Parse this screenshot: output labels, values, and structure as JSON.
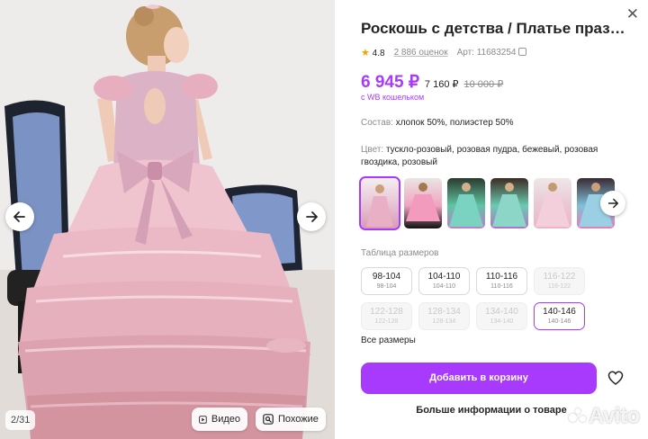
{
  "gallery": {
    "counter": "2/31",
    "video_label": "Видео",
    "similar_label": "Похожие"
  },
  "product": {
    "title": "Роскошь с детства / Платье праздничное",
    "rating": "4.8",
    "reviews": "2 886 оценок",
    "article": "Арт: 11683254",
    "price_main": "6 945 ₽",
    "price_sub": "7 160 ₽",
    "price_old": "10 000 ₽",
    "wallet_note": "с WB кошельком",
    "composition_label": "Состав:",
    "composition": "хлопок 50%, полиэстер 50%",
    "colors_label": "Цвет:",
    "colors": "тускло-розовый, розовая пудра, бежевый, розовая гвоздика, розовый"
  },
  "sizes": {
    "title": "Таблица размеров",
    "items": [
      {
        "main": "98-104",
        "sub": "98-104"
      },
      {
        "main": "104-110",
        "sub": "104-110"
      },
      {
        "main": "110-116",
        "sub": "110-116"
      },
      {
        "main": "116-122",
        "sub": "116-122"
      },
      {
        "main": "122-128",
        "sub": "122-128"
      },
      {
        "main": "128-134",
        "sub": "128-134"
      },
      {
        "main": "134-140",
        "sub": "134-140"
      },
      {
        "main": "140-146",
        "sub": "140-146"
      }
    ],
    "all_label": "Все размеры"
  },
  "actions": {
    "add_to_cart": "Добавить в корзину",
    "more_info": "Больше информации о товаре"
  },
  "watermark": "Avito",
  "colors_theme": {
    "accent": "#a73afd",
    "text": "#242424",
    "muted": "#8b8b8b",
    "star": "#f4a300"
  },
  "icons": {
    "close": "close-icon",
    "prev": "arrow-left-icon",
    "next": "arrow-right-icon",
    "play": "play-icon",
    "similar": "image-search-icon",
    "favorite": "heart-icon",
    "copy": "copy-icon",
    "star": "star-icon"
  }
}
